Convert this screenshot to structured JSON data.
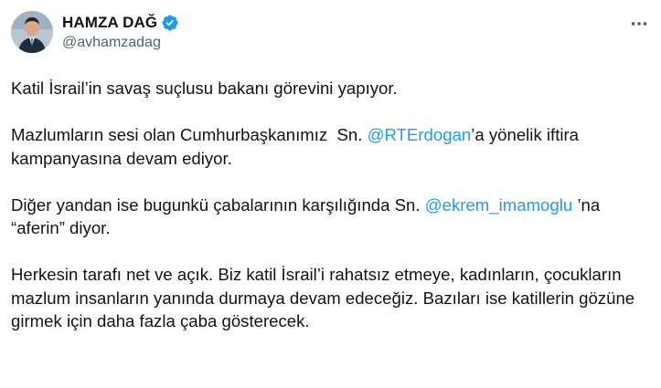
{
  "author": {
    "display_name": "HAMZA DAĞ",
    "handle": "@avhamzadag",
    "verified": true,
    "verified_color": "#1d9bf0",
    "avatar_icon": "profile-photo-icon"
  },
  "more_icon": "more-options-icon",
  "tweet": {
    "p1": "Katil İsrail’in savaş suçlusu bakanı görevini yapıyor.",
    "p2_before": "Mazlumların sesi olan Cumhurbaşkanımız  Sn. ",
    "p2_mention": "@RTErdogan",
    "p2_after": "’a yönelik iftira kampanyasına devam ediyor.",
    "p3_before": "Diğer yandan ise bugunkü çabalarının karşılığında Sn. ",
    "p3_mention": "@ekrem_imamoglu",
    "p3_after": " ’na “aferin” diyor.",
    "p4": "Herkesin tarafı net ve açık. Biz katil İsrail’i rahatsız etmeye, kadınların, çocukların mazlum insanların yanında durmaya devam edeceğiz. Bazıları ise katillerin gözüne girmek için daha fazla çaba gösterecek."
  },
  "colors": {
    "text": "#0f1419",
    "secondary": "#536471",
    "link": "#1d9bf0"
  }
}
